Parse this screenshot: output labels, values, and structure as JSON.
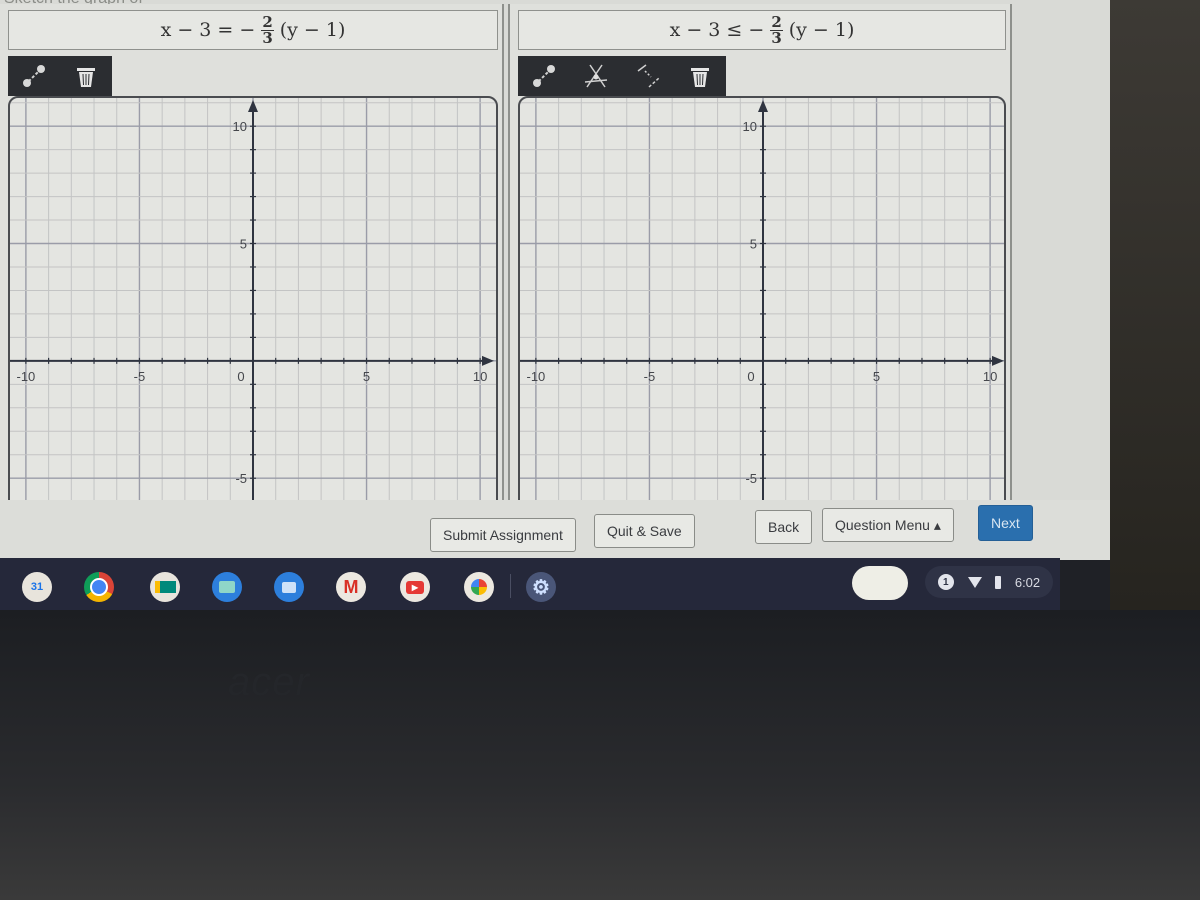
{
  "page": {
    "prompt_text": "Sketch the graph of"
  },
  "left_panel": {
    "equation": {
      "lhs": "x − 3 = −",
      "frac_num": "2",
      "frac_den": "3",
      "rhs": "(y − 1)"
    },
    "tools": [
      {
        "name": "line-tool",
        "icon": "two-point-line-icon"
      },
      {
        "name": "delete-tool",
        "icon": "trash-icon"
      }
    ]
  },
  "right_panel": {
    "equation": {
      "lhs": "x − 3 ≤ −",
      "frac_num": "2",
      "frac_den": "3",
      "rhs": "(y − 1)"
    },
    "tools": [
      {
        "name": "line-tool",
        "icon": "two-point-line-icon"
      },
      {
        "name": "region-tool",
        "icon": "shade-region-icon"
      },
      {
        "name": "dashed-line-tool",
        "icon": "dashed-line-icon"
      },
      {
        "name": "delete-tool",
        "icon": "trash-icon"
      }
    ]
  },
  "graph_axes": {
    "x_range": [
      -10,
      10
    ],
    "y_range": [
      -10,
      10
    ],
    "tick_labels_x": [
      "-10",
      "-5",
      "0",
      "5",
      "10"
    ],
    "tick_labels_y": [
      "10",
      "5",
      "-5"
    ],
    "grid_step": 1,
    "major_step": 5
  },
  "buttons": {
    "submit": "Submit Assignment",
    "quit_save": "Quit & Save",
    "back": "Back",
    "question_menu": "Question Menu ▴",
    "next": "Next"
  },
  "colors": {
    "next_button": "#2a6fae",
    "toolbar": "#2b2d31",
    "shelf": "#25283a"
  },
  "shelf": {
    "apps": [
      {
        "name": "calendar",
        "label": "31"
      },
      {
        "name": "chrome",
        "label": ""
      },
      {
        "name": "meet",
        "label": ""
      },
      {
        "name": "files",
        "label": ""
      },
      {
        "name": "messages",
        "label": ""
      },
      {
        "name": "gmail",
        "label": "M"
      },
      {
        "name": "youtube",
        "label": "▶"
      },
      {
        "name": "photos",
        "label": ""
      },
      {
        "name": "settings",
        "label": "⚙"
      }
    ],
    "notification_count": "1",
    "time": "6:02"
  },
  "bezel": {
    "brand": "acer"
  }
}
